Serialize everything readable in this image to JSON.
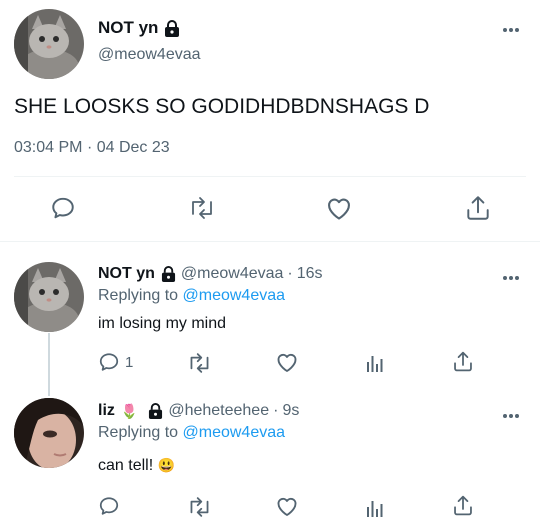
{
  "main_tweet": {
    "display_name": "NOT yn",
    "handle": "@meow4evaa",
    "text": "SHE LOOSKS SO GODIDHDBDNSHAGS D",
    "time": "03:04 PM",
    "date": "04 Dec 23",
    "date_sep": "·",
    "locked": true
  },
  "replies": [
    {
      "display_name": "NOT yn",
      "handle": "@meow4evaa",
      "meta_sep": "·",
      "age": "16s",
      "replying_label": "Replying to",
      "replying_to": "@meow4evaa",
      "text": "im losing my mind",
      "reply_count": "1"
    },
    {
      "display_name": "liz",
      "name_emoji": "🌷",
      "handle": "@heheteehee",
      "meta_sep": "·",
      "age": "9s",
      "replying_label": "Replying to",
      "replying_to": "@meow4evaa",
      "text": "can tell!",
      "text_emoji": "😃"
    }
  ],
  "colors": {
    "accent": "#1d9bf0",
    "muted": "#536471",
    "border": "#eff3f4",
    "text": "#0f1419"
  },
  "icons": {
    "reply": "reply-icon",
    "retweet": "retweet-icon",
    "like": "heart-icon",
    "share": "share-icon",
    "views": "views-icon",
    "lock": "lock-icon",
    "more": "more-icon"
  }
}
